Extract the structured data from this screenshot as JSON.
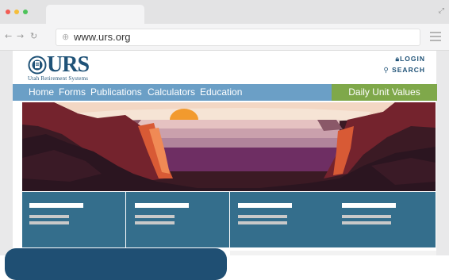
{
  "browser": {
    "url": "www.urs.org",
    "window_controls": [
      "close",
      "minimize",
      "maximize"
    ],
    "colors": {
      "close": "#f25c54",
      "minimize": "#f5be3b",
      "maximize": "#4dc35a"
    }
  },
  "site": {
    "logo_text": "URS",
    "logo_subtitle": "Utah Retirement Systems",
    "login_label": "LOGIN",
    "search_label": "SEARCH",
    "nav_items": [
      "Home",
      "Forms",
      "Publications",
      "Calculators",
      "Education"
    ],
    "daily_unit_values_label": "Daily Unit Values",
    "colors": {
      "brand": "#1f5277",
      "nav": "#6b9fc6",
      "accent": "#7fa84a",
      "tiles": "#346e8c"
    }
  }
}
